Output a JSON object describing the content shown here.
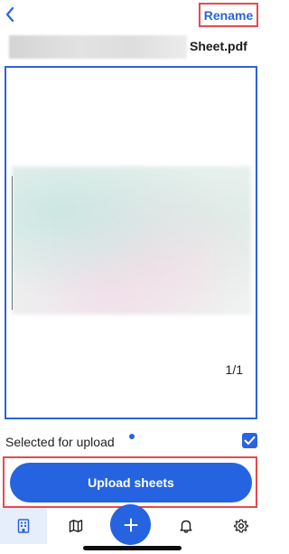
{
  "header": {
    "back_icon": "chevron-left-icon",
    "rename_label": "Rename"
  },
  "file": {
    "name_suffix": "Sheet.pdf"
  },
  "preview": {
    "page_indicator": "1/1"
  },
  "selection": {
    "label": "Selected for upload",
    "checked": true
  },
  "actions": {
    "upload_label": "Upload sheets"
  },
  "tab_bar": {
    "items": [
      {
        "icon": "building-icon",
        "active": true
      },
      {
        "icon": "map-icon",
        "active": false
      },
      {
        "icon": "plus-icon",
        "active": false
      },
      {
        "icon": "bell-icon",
        "active": false
      },
      {
        "icon": "gear-icon",
        "active": false
      }
    ]
  },
  "colors": {
    "accent": "#2563e0",
    "highlight_outline": "#e34b4f",
    "active_tab_bg": "#e6eefb"
  }
}
